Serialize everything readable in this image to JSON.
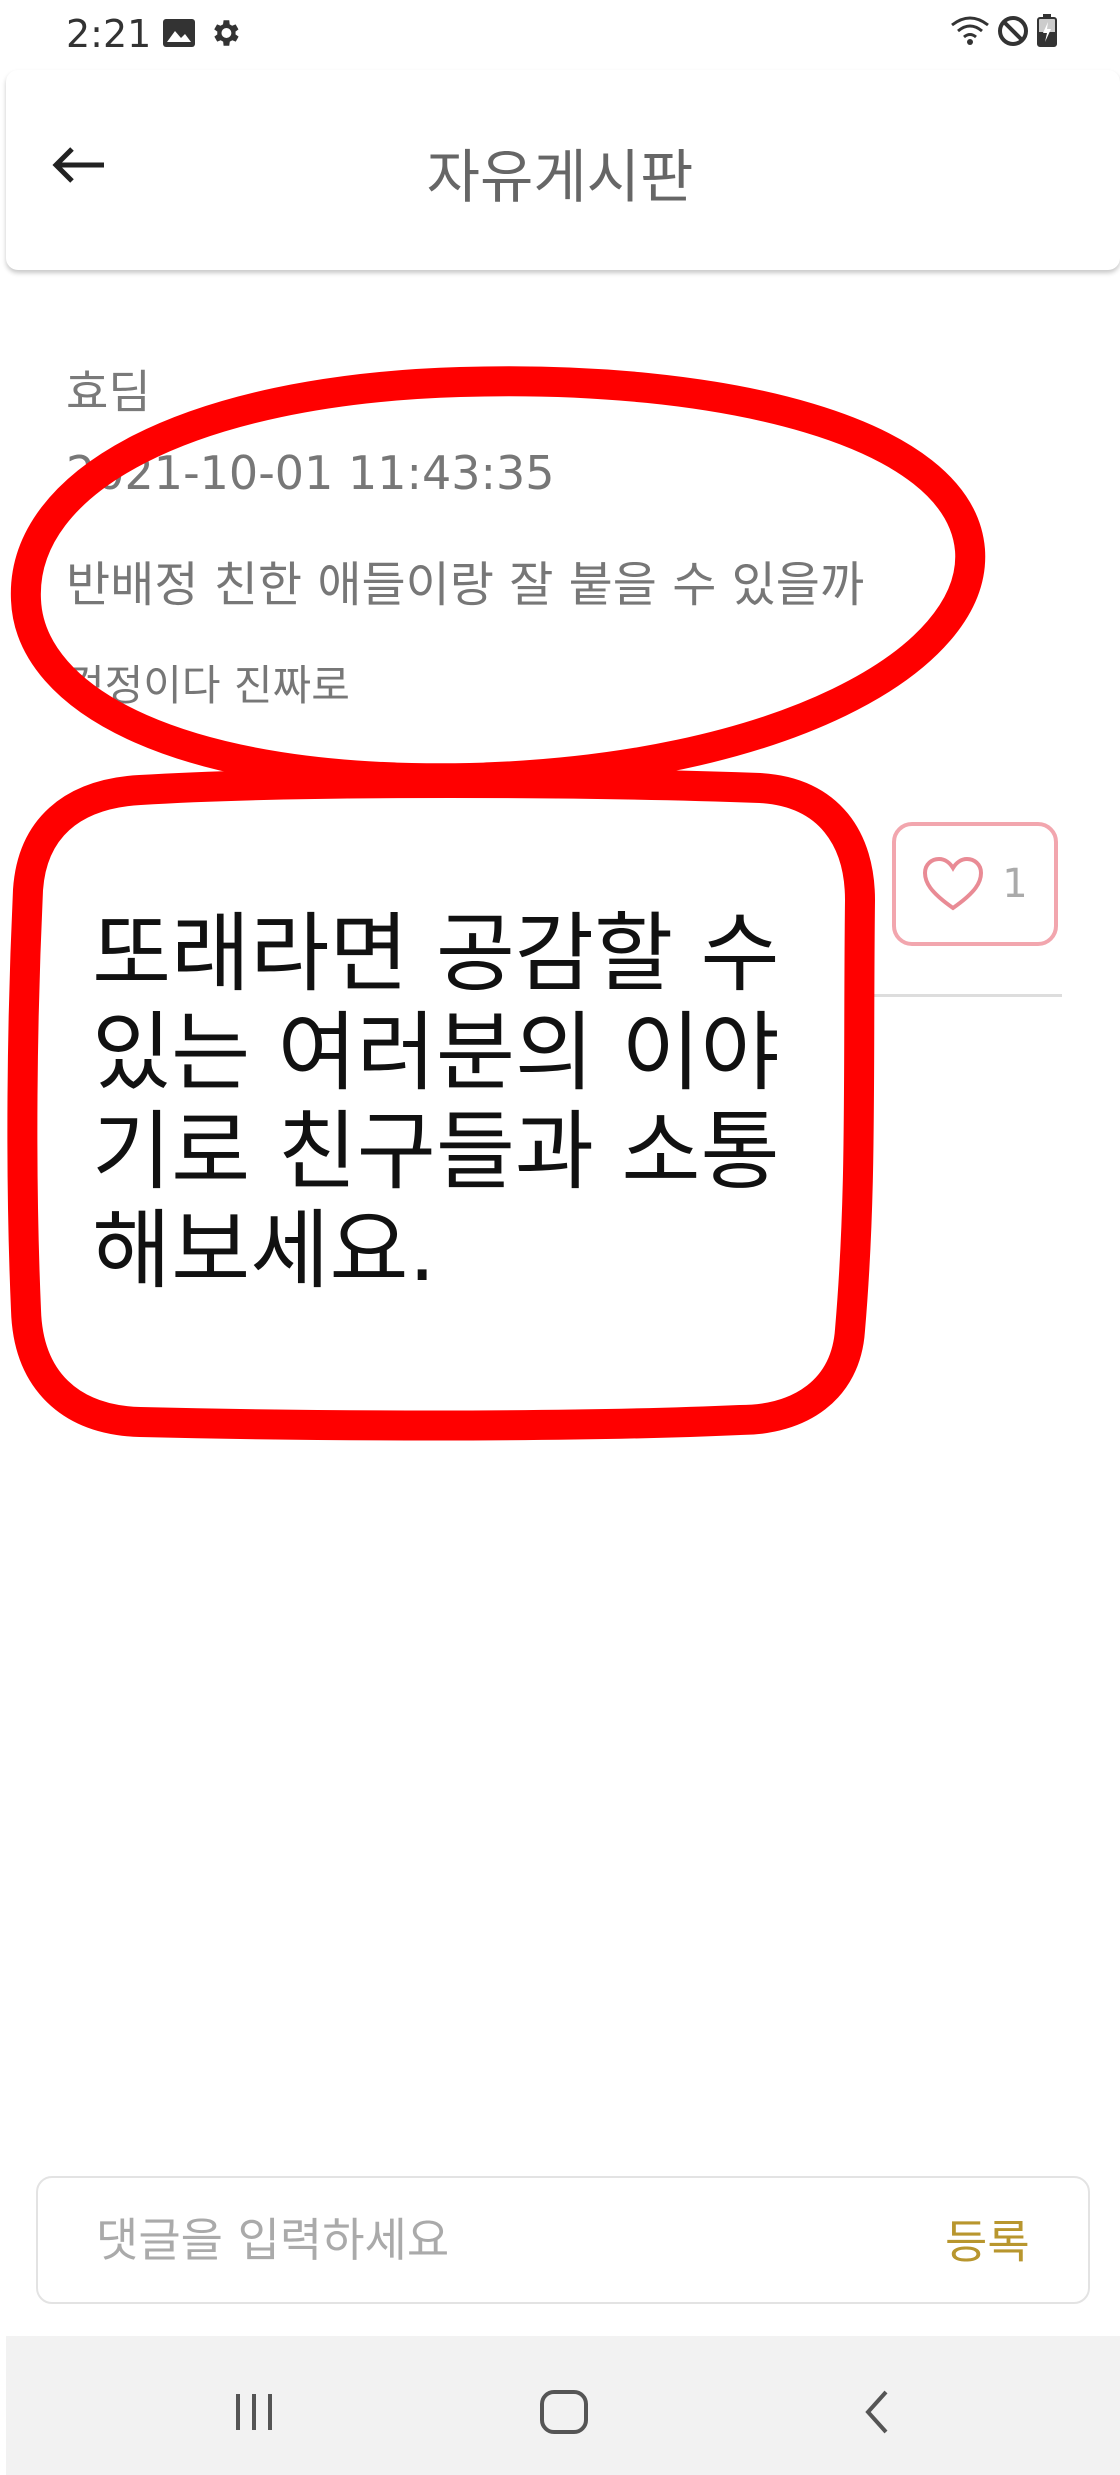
{
  "status_bar": {
    "time": "2:21",
    "icons": [
      "image-icon",
      "gear-icon",
      "wifi-icon",
      "do-not-disturb-icon",
      "battery-charging-icon"
    ]
  },
  "app_bar": {
    "title": "자유게시판",
    "back_icon": "back-arrow-icon"
  },
  "post": {
    "author": "효딤",
    "date": "2021-10-01 11:43:35",
    "title": "반배정 친한 애들이랑 잘 붙을 수 있을까",
    "body": "걱정이다 진짜로",
    "like_count": "1",
    "like_icon": "heart-icon"
  },
  "annotation": {
    "text": "또래라면 공감할 수 있는 여러분의 이야기로 친구들과 소통해보세요.",
    "color": "#ff0000"
  },
  "comment": {
    "placeholder": "댓글을 입력하세요",
    "submit_label": "등록"
  },
  "nav": {
    "icons": [
      "recent-apps-icon",
      "home-icon",
      "back-icon"
    ]
  },
  "colors": {
    "accent_gold": "#b8962e",
    "like_border": "#f2a6ae",
    "annotation_red": "#ff0000"
  }
}
